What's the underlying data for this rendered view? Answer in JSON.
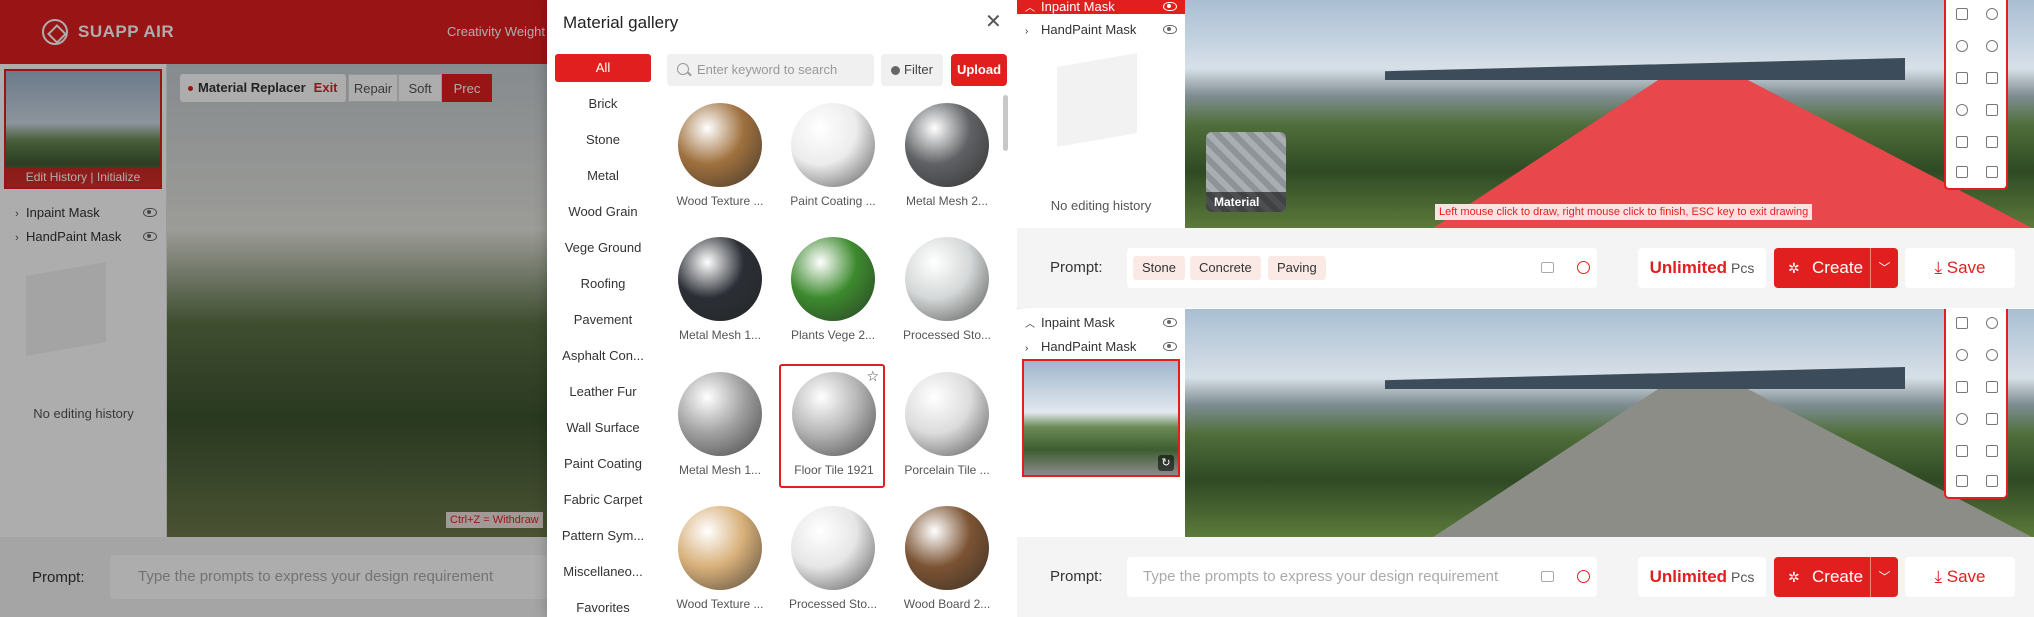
{
  "left_app": {
    "brand": "SUAPP AIR",
    "tagline": "Creativity Weight",
    "thumb_caption": "Edit History | Initialize",
    "layers": [
      "Inpaint Mask",
      "HandPaint Mask"
    ],
    "empty_history": "No editing history",
    "tool_title": "Material Replacer",
    "exit_label": "Exit",
    "modes": [
      "Repair",
      "Soft",
      "Prec"
    ],
    "undo_hint": "Ctrl+Z = Withdraw",
    "prompt_label": "Prompt:",
    "prompt_placeholder": "Type the prompts to express your design requirement"
  },
  "gallery": {
    "title": "Material gallery",
    "categories": [
      "All",
      "Brick",
      "Stone",
      "Metal",
      "Wood Grain",
      "Vege Ground",
      "Roofing",
      "Pavement",
      "Asphalt Con...",
      "Leather Fur",
      "Wall Surface",
      "Paint Coating",
      "Fabric Carpet",
      "Pattern Sym...",
      "Miscellaneo...",
      "Favorites"
    ],
    "search_placeholder": "Enter keyword to search",
    "filter_label": "Filter",
    "upload_label": "Upload",
    "materials": [
      {
        "label": "Wood Texture ...",
        "color": "#a0713f"
      },
      {
        "label": "Paint Coating ...",
        "color": "#ececec"
      },
      {
        "label": "Metal Mesh 2...",
        "color": "#5f6164"
      },
      {
        "label": "Metal Mesh 1...",
        "color": "#2b2f35"
      },
      {
        "label": "Plants Vege 2...",
        "color": "#3d8a2e"
      },
      {
        "label": "Processed Sto...",
        "color": "#d5d8d8"
      },
      {
        "label": "Metal Mesh 1...",
        "color": "#a2a2a2"
      },
      {
        "label": "Floor Tile 1921",
        "color": "#b7b7b7"
      },
      {
        "label": "Porcelain Tile ...",
        "color": "#dcdcdc"
      },
      {
        "label": "Wood Texture ...",
        "color": "#d8b07a"
      },
      {
        "label": "Processed Sto...",
        "color": "#e6e6e6"
      },
      {
        "label": "Wood Board 2...",
        "color": "#7c5434"
      }
    ]
  },
  "top_view": {
    "layers": [
      "Inpaint Mask",
      "HandPaint Mask"
    ],
    "empty_history": "No editing history",
    "material_badge": "Material",
    "draw_hint": "Left mouse click to draw, right mouse click to finish, ESC key to exit drawing",
    "prompt_label": "Prompt:",
    "chips": [
      "Stone",
      "Concrete",
      "Paving"
    ],
    "count_value": "Unlimited",
    "count_unit": "Pcs",
    "create_label": "Create",
    "save_label": "Save"
  },
  "bottom_view": {
    "layers": [
      "Inpaint Mask",
      "HandPaint Mask"
    ],
    "prompt_label": "Prompt:",
    "prompt_placeholder": "Type the prompts to express your design requirement",
    "count_value": "Unlimited",
    "count_unit": "Pcs",
    "create_label": "Create",
    "save_label": "Save"
  },
  "colors": {
    "accent": "#e21f1f",
    "mask": "#e8474c"
  }
}
